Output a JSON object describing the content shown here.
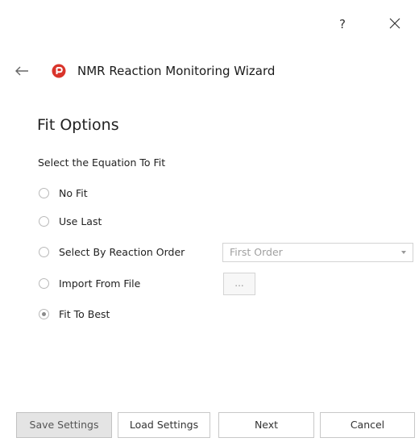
{
  "titlebar": {
    "help_label": "?",
    "close_icon": "close-icon"
  },
  "header": {
    "back_icon": "back-arrow-icon",
    "logo_icon": "app-logo-icon",
    "logo_color": "#d9342b",
    "title": "NMR Reaction Monitoring Wizard"
  },
  "section": {
    "title": "Fit Options",
    "subheading": "Select the Equation To Fit"
  },
  "options": [
    {
      "label": "No Fit",
      "checked": false
    },
    {
      "label": "Use Last",
      "checked": false
    },
    {
      "label": "Select By Reaction Order",
      "checked": false
    },
    {
      "label": "Import From File",
      "checked": false
    },
    {
      "label": "Fit To Best",
      "checked": true
    }
  ],
  "reaction_order": {
    "selected": "First Order"
  },
  "import_file": {
    "browse_label": "..."
  },
  "footer": {
    "save_label": "Save Settings",
    "load_label": "Load Settings",
    "next_label": "Next",
    "cancel_label": "Cancel"
  }
}
